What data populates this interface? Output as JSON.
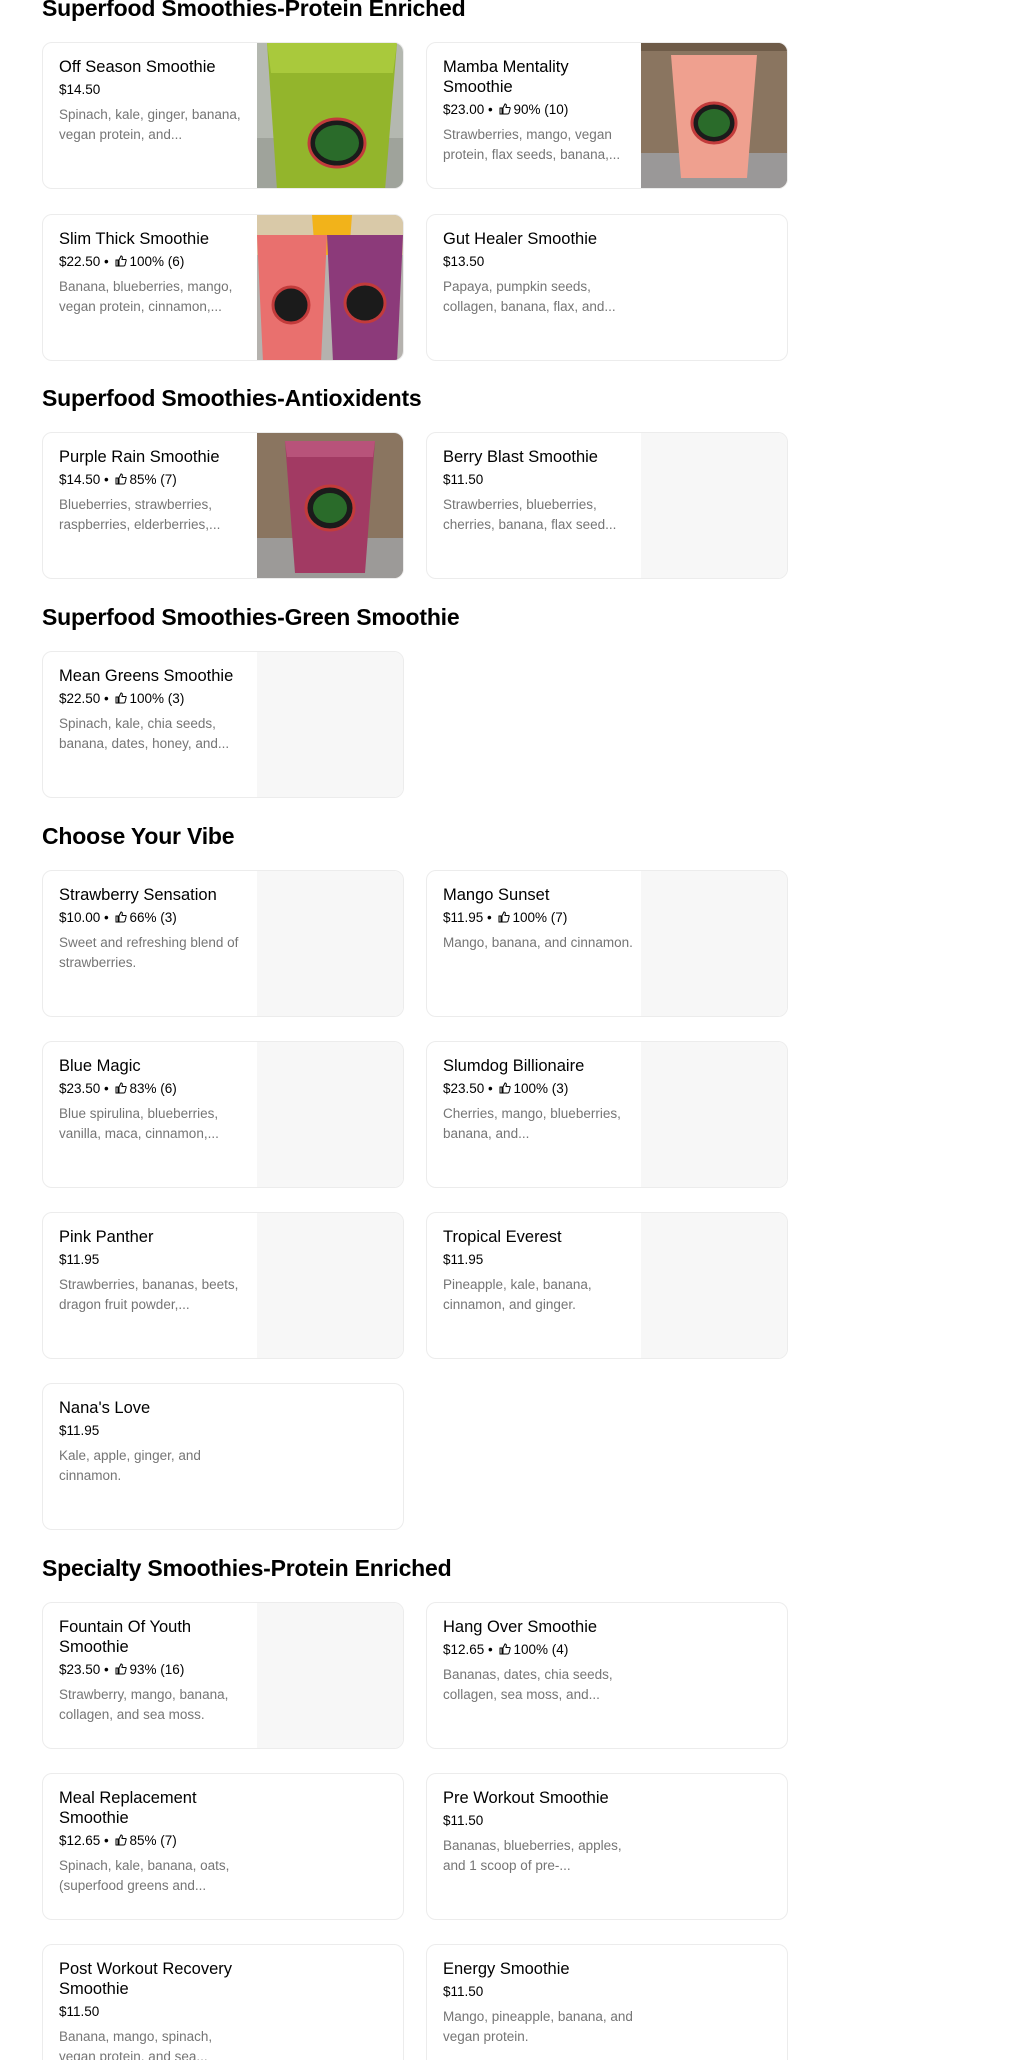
{
  "sections": [
    {
      "title": "Superfood Smoothies-Protein Enriched",
      "items": [
        {
          "name": "Off Season Smoothie",
          "price": "$14.50",
          "rating": "",
          "desc": "Spinach, kale, ginger, banana, vegan protein, and..."
        },
        {
          "name": "Mamba Mentality Smoothie",
          "price": "$23.00",
          "rating": "90% (10)",
          "desc": "Strawberries, mango, vegan protein, flax seeds, banana,..."
        },
        {
          "name": "Slim Thick Smoothie",
          "price": "$22.50",
          "rating": "100% (6)",
          "desc": "Banana, blueberries, mango, vegan protein, cinnamon,..."
        },
        {
          "name": "Gut Healer Smoothie",
          "price": "$13.50",
          "rating": "",
          "desc": "Papaya, pumpkin seeds, collagen, banana, flax, and..."
        }
      ]
    },
    {
      "title": "Superfood Smoothies-Antioxidents",
      "items": [
        {
          "name": "Purple Rain Smoothie",
          "price": "$14.50",
          "rating": "85% (7)",
          "desc": "Blueberries, strawberries, raspberries, elderberries,..."
        },
        {
          "name": "Berry Blast Smoothie",
          "price": "$11.50",
          "rating": "",
          "desc": "Strawberries, blueberries, cherries, banana, flax seed..."
        }
      ]
    },
    {
      "title": "Superfood Smoothies-Green Smoothie",
      "items": [
        {
          "name": "Mean Greens Smoothie",
          "price": "$22.50",
          "rating": "100% (3)",
          "desc": "Spinach, kale, chia seeds, banana, dates, honey, and..."
        }
      ]
    },
    {
      "title": "Choose Your Vibe",
      "items": [
        {
          "name": "Strawberry Sensation",
          "price": "$10.00",
          "rating": "66% (3)",
          "desc": "Sweet and refreshing blend of strawberries."
        },
        {
          "name": "Mango Sunset",
          "price": "$11.95",
          "rating": "100% (7)",
          "desc": "Mango, banana, and cinnamon."
        },
        {
          "name": "Blue Magic",
          "price": "$23.50",
          "rating": "83% (6)",
          "desc": "Blue spirulina, blueberries, vanilla, maca, cinnamon,..."
        },
        {
          "name": "Slumdog Billionaire",
          "price": "$23.50",
          "rating": "100% (3)",
          "desc": "Cherries, mango, blueberries, banana, and..."
        },
        {
          "name": "Pink Panther",
          "price": "$11.95",
          "rating": "",
          "desc": "Strawberries, bananas, beets, dragon fruit powder,..."
        },
        {
          "name": "Tropical Everest",
          "price": "$11.95",
          "rating": "",
          "desc": "Pineapple, kale, banana, cinnamon, and ginger."
        },
        {
          "name": "Nana's Love",
          "price": "$11.95",
          "rating": "",
          "desc": "Kale, apple, ginger, and cinnamon."
        }
      ]
    },
    {
      "title": "Specialty Smoothies-Protein Enriched",
      "items": [
        {
          "name": "Fountain Of Youth Smoothie",
          "price": "$23.50",
          "rating": "93% (16)",
          "desc": "Strawberry, mango, banana, collagen, and sea moss."
        },
        {
          "name": "Hang Over Smoothie",
          "price": "$12.65",
          "rating": "100% (4)",
          "desc": "Bananas, dates, chia seeds, collagen, sea moss, and..."
        },
        {
          "name": "Meal Replacement Smoothie",
          "price": "$12.65",
          "rating": "85% (7)",
          "desc": "Spinach, kale, banana, oats, (superfood greens and..."
        },
        {
          "name": "Pre Workout Smoothie",
          "price": "$11.50",
          "rating": "",
          "desc": "Bananas, blueberries, apples, and 1 scoop of pre-..."
        },
        {
          "name": "Post Workout Recovery Smoothie",
          "price": "$11.50",
          "rating": "",
          "desc": "Banana, mango, spinach, vegan protein, and sea..."
        },
        {
          "name": "Energy Smoothie",
          "price": "$11.50",
          "rating": "",
          "desc": "Mango, pineapple, banana, and vegan protein."
        }
      ]
    }
  ],
  "separator": " • ",
  "colors": {
    "placeholder": "#f7f7f7",
    "border": "#ececec",
    "desc": "#757575"
  }
}
